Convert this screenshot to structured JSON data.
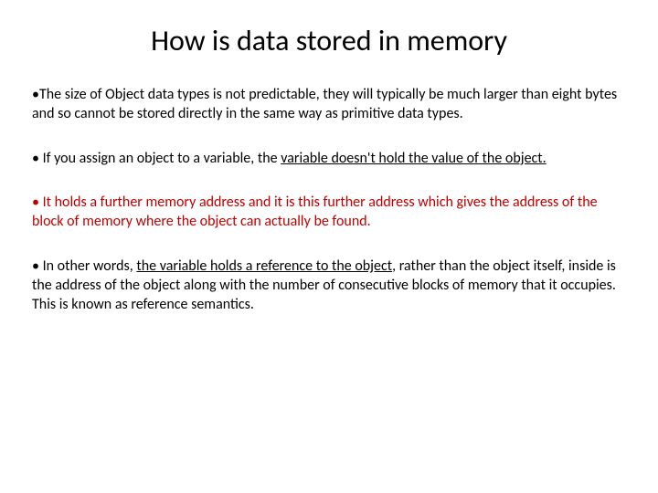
{
  "title": "How is data stored in memory",
  "bullets": {
    "b1": "The size of Object data types is not predictable, they will typically be much larger than eight bytes and so cannot be stored directly in the same way as primitive data types.",
    "b2_pre": "If you assign an object to a variable, the ",
    "b2_underline": "variable doesn't hold the value of the object.",
    "b3": "It holds a further memory address and it is this further address which gives the address of the block of memory where the object can actually be found.",
    "b4_pre": "In other words, ",
    "b4_underline": "the variable holds a reference to the object",
    "b4_post": ", rather than the object itself, inside is the address of the object along with the number of consecutive blocks of memory that it occupies. This is known as reference semantics."
  },
  "bullet_char": "•"
}
